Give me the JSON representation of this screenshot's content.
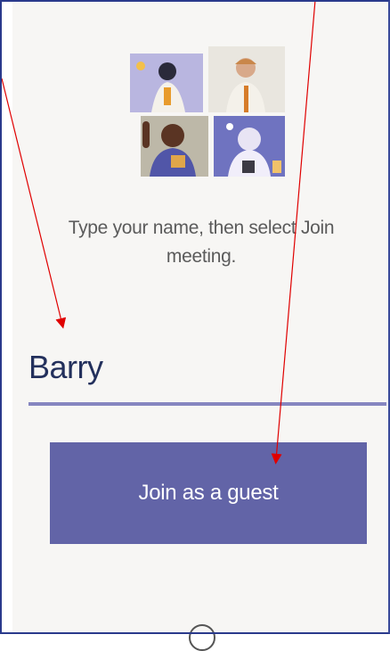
{
  "prompt": {
    "line1": "Type your name, then select Join",
    "line2": "meeting."
  },
  "name_input": {
    "value": "Barry"
  },
  "join_button": {
    "label": "Join as a guest"
  },
  "illustration": {
    "icon": "video-call-participants-illustration"
  },
  "colors": {
    "accent": "#6264a7",
    "underline": "#8686c0",
    "annotation_arrow": "#e00000",
    "frame_border": "#2a3a8c"
  },
  "annotations": {
    "arrows": [
      {
        "target": "name-input",
        "icon": "red-arrow"
      },
      {
        "target": "join-as-guest-button",
        "icon": "red-arrow"
      }
    ]
  }
}
